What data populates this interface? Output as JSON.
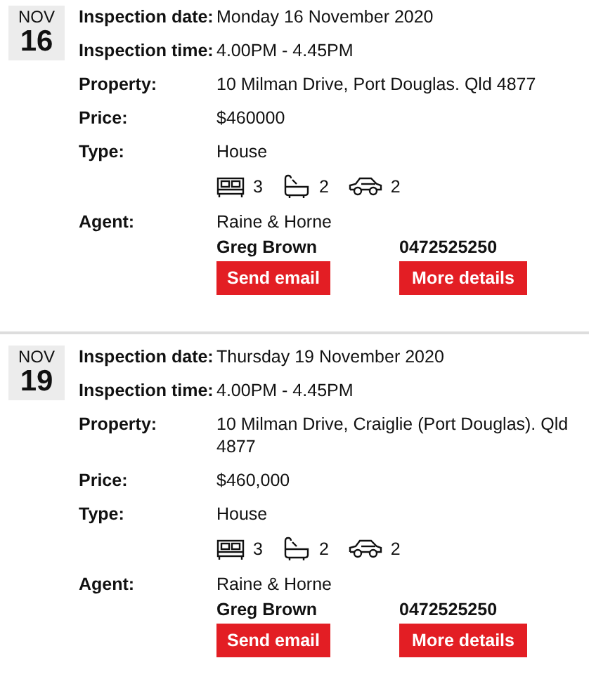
{
  "inspections": [
    {
      "month": "NOV",
      "day": "16",
      "fields": [
        {
          "label": "Inspection date:",
          "value": "Monday 16 November 2020"
        },
        {
          "label": "Inspection time:",
          "value": "4.00PM - 4.45PM"
        },
        {
          "label": "Property:",
          "value": "10 Milman Drive, Port Douglas. Qld 4877"
        },
        {
          "label": "Price:",
          "value": "$460000"
        },
        {
          "label": "Type:",
          "value": "House"
        }
      ],
      "features": [
        {
          "kind": "bed",
          "count": "3"
        },
        {
          "kind": "bath",
          "count": "2"
        },
        {
          "kind": "car",
          "count": "2"
        }
      ],
      "agent": {
        "label": "Agent:",
        "agency": "Raine & Horne",
        "name": "Greg Brown",
        "phone": "0472525250"
      },
      "buttons": [
        "Send email",
        "More details"
      ]
    },
    {
      "month": "NOV",
      "day": "19",
      "fields": [
        {
          "label": "Inspection date:",
          "value": "Thursday 19 November 2020"
        },
        {
          "label": "Inspection time:",
          "value": "4.00PM - 4.45PM"
        },
        {
          "label": "Property:",
          "value": "10 Milman Drive, Craiglie (Port Douglas). Qld 4877"
        },
        {
          "label": "Price:",
          "value": "$460,000"
        },
        {
          "label": "Type:",
          "value": "House"
        }
      ],
      "features": [
        {
          "kind": "bed",
          "count": "3"
        },
        {
          "kind": "bath",
          "count": "2"
        },
        {
          "kind": "car",
          "count": "2"
        }
      ],
      "agent": {
        "label": "Agent:",
        "agency": "Raine & Horne",
        "name": "Greg Brown",
        "phone": "0472525250"
      },
      "buttons": [
        "Send email",
        "More details"
      ]
    }
  ]
}
